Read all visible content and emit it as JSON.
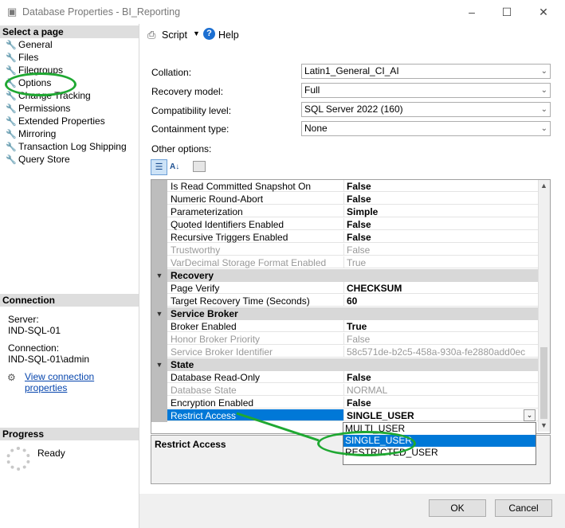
{
  "window": {
    "title": "Database Properties - BI_Reporting"
  },
  "sidebar": {
    "select_page_header": "Select a page",
    "items": [
      "General",
      "Files",
      "Filegroups",
      "Options",
      "Change Tracking",
      "Permissions",
      "Extended Properties",
      "Mirroring",
      "Transaction Log Shipping",
      "Query Store"
    ],
    "selected": "Options",
    "connection_header": "Connection",
    "server_label": "Server:",
    "server_value": "IND-SQL-01",
    "connection_label": "Connection:",
    "connection_value": "IND-SQL-01\\admin",
    "view_link": "View connection properties",
    "progress_header": "Progress",
    "progress_status": "Ready"
  },
  "toolbar": {
    "script_label": "Script",
    "help_label": "Help"
  },
  "options": {
    "collation_label": "Collation:",
    "collation_value": "Latin1_General_CI_AI",
    "recovery_label": "Recovery model:",
    "recovery_value": "Full",
    "compat_label": "Compatibility level:",
    "compat_value": "SQL Server 2022 (160)",
    "containment_label": "Containment type:",
    "containment_value": "None",
    "other_label": "Other options:"
  },
  "grid_rows": [
    {
      "name": "Is Read Committed Snapshot On",
      "value": "False"
    },
    {
      "name": "Numeric Round-Abort",
      "value": "False"
    },
    {
      "name": "Parameterization",
      "value": "Simple"
    },
    {
      "name": "Quoted Identifiers Enabled",
      "value": "False"
    },
    {
      "name": "Recursive Triggers Enabled",
      "value": "False"
    },
    {
      "name": "Trustworthy",
      "value": "False"
    },
    {
      "name": "VarDecimal Storage Format Enabled",
      "value": "True"
    },
    {
      "name": "Recovery",
      "value": ""
    },
    {
      "name": "Page Verify",
      "value": "CHECKSUM"
    },
    {
      "name": "Target Recovery Time (Seconds)",
      "value": "60"
    },
    {
      "name": "Service Broker",
      "value": ""
    },
    {
      "name": "Broker Enabled",
      "value": "True"
    },
    {
      "name": "Honor Broker Priority",
      "value": "False"
    },
    {
      "name": "Service Broker Identifier",
      "value": "58c571de-b2c5-458a-930a-fe2880add0ec"
    },
    {
      "name": "State",
      "value": ""
    },
    {
      "name": "Database Read-Only",
      "value": "False"
    },
    {
      "name": "Database State",
      "value": "NORMAL"
    },
    {
      "name": "Encryption Enabled",
      "value": "False"
    },
    {
      "name": "Restrict Access",
      "value": "SINGLE_USER"
    }
  ],
  "dropdown_options": [
    "MULTI_USER",
    "SINGLE_USER",
    "RESTRICTED_USER"
  ],
  "description_title": "Restrict Access",
  "buttons": {
    "ok": "OK",
    "cancel": "Cancel"
  },
  "colors": {
    "selection": "#0078d7",
    "annotation": "#1fa832"
  }
}
